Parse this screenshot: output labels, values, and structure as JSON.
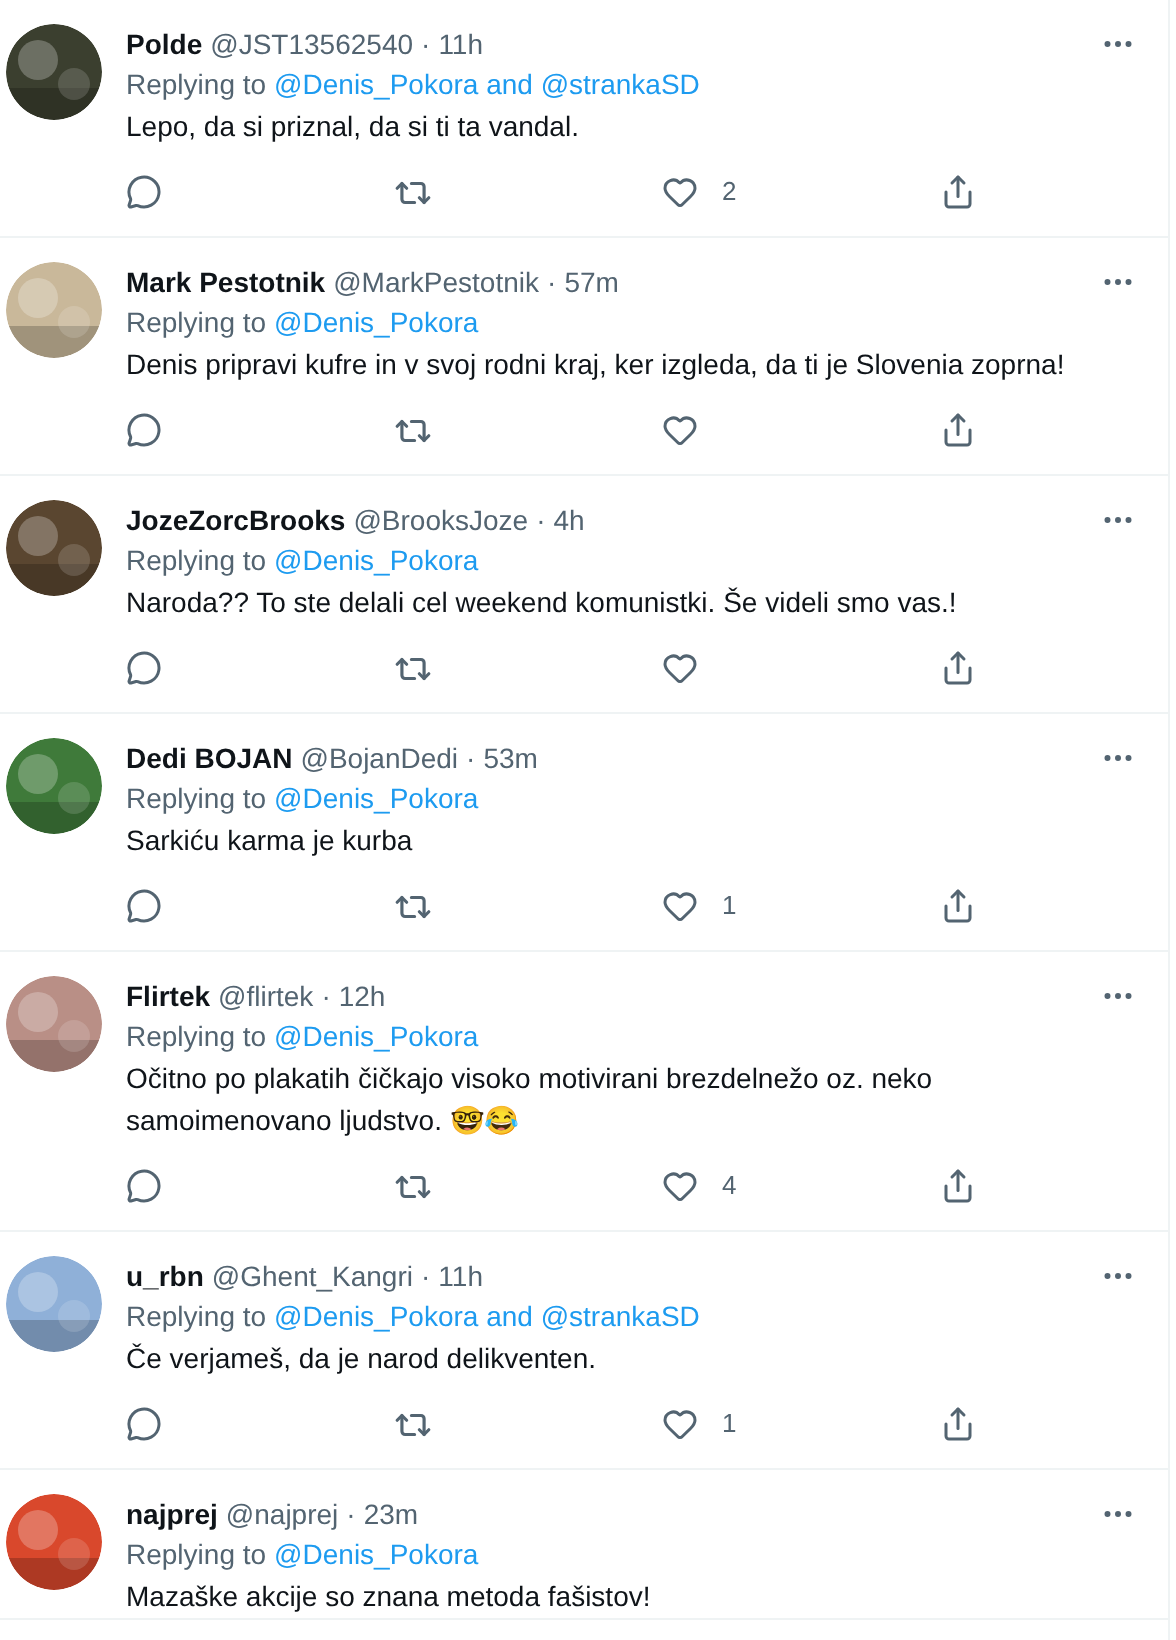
{
  "tweets": [
    {
      "name": "Polde",
      "handle": "@JST13562540",
      "separator": "·",
      "time": "11h",
      "replying_label": "Replying to",
      "reply_to": "@Denis_Pokora and @strankaSD",
      "text": "Lepo, da si priznal, da si ti ta vandal.",
      "likes": "2"
    },
    {
      "name": "Mark Pestotnik",
      "handle": "@MarkPestotnik",
      "separator": "·",
      "time": "57m",
      "replying_label": "Replying to",
      "reply_to": "@Denis_Pokora",
      "text": "Denis pripravi kufre in v svoj rodni kraj, ker izgleda, da ti je Slovenia zoprna!"
    },
    {
      "name": "JozeZorcBrooks",
      "handle": "@BrooksJoze",
      "separator": "·",
      "time": "4h",
      "replying_label": "Replying to",
      "reply_to": "@Denis_Pokora",
      "text": "Naroda?? To ste delali cel weekend komunistki. Še videli smo vas.!"
    },
    {
      "name": "Dedi BOJAN",
      "handle": "@BojanDedi",
      "separator": "·",
      "time": "53m",
      "replying_label": "Replying to",
      "reply_to": "@Denis_Pokora",
      "text": "Sarkiću karma je kurba",
      "likes": "1"
    },
    {
      "name": "Flirtek",
      "handle": "@flirtek",
      "separator": "·",
      "time": "12h",
      "replying_label": "Replying to",
      "reply_to": "@Denis_Pokora",
      "text": "Očitno po plakatih čičkajo visoko motivirani brezdelnežo oz. neko samoimenovano ljudstvo. 🤓😂",
      "likes": "4"
    },
    {
      "name": "u_rbn",
      "handle": "@Ghent_Kangri",
      "separator": "·",
      "time": "11h",
      "replying_label": "Replying to",
      "reply_to": "@Denis_Pokora and @strankaSD",
      "text": "Če verjameš, da je narod delikventen.",
      "likes": "1"
    },
    {
      "name": "najprej",
      "handle": "@najprej",
      "separator": "·",
      "time": "23m",
      "replying_label": "Replying to",
      "reply_to": "@Denis_Pokora",
      "text": "Mazaške akcije so znana metoda fašistov!"
    }
  ]
}
